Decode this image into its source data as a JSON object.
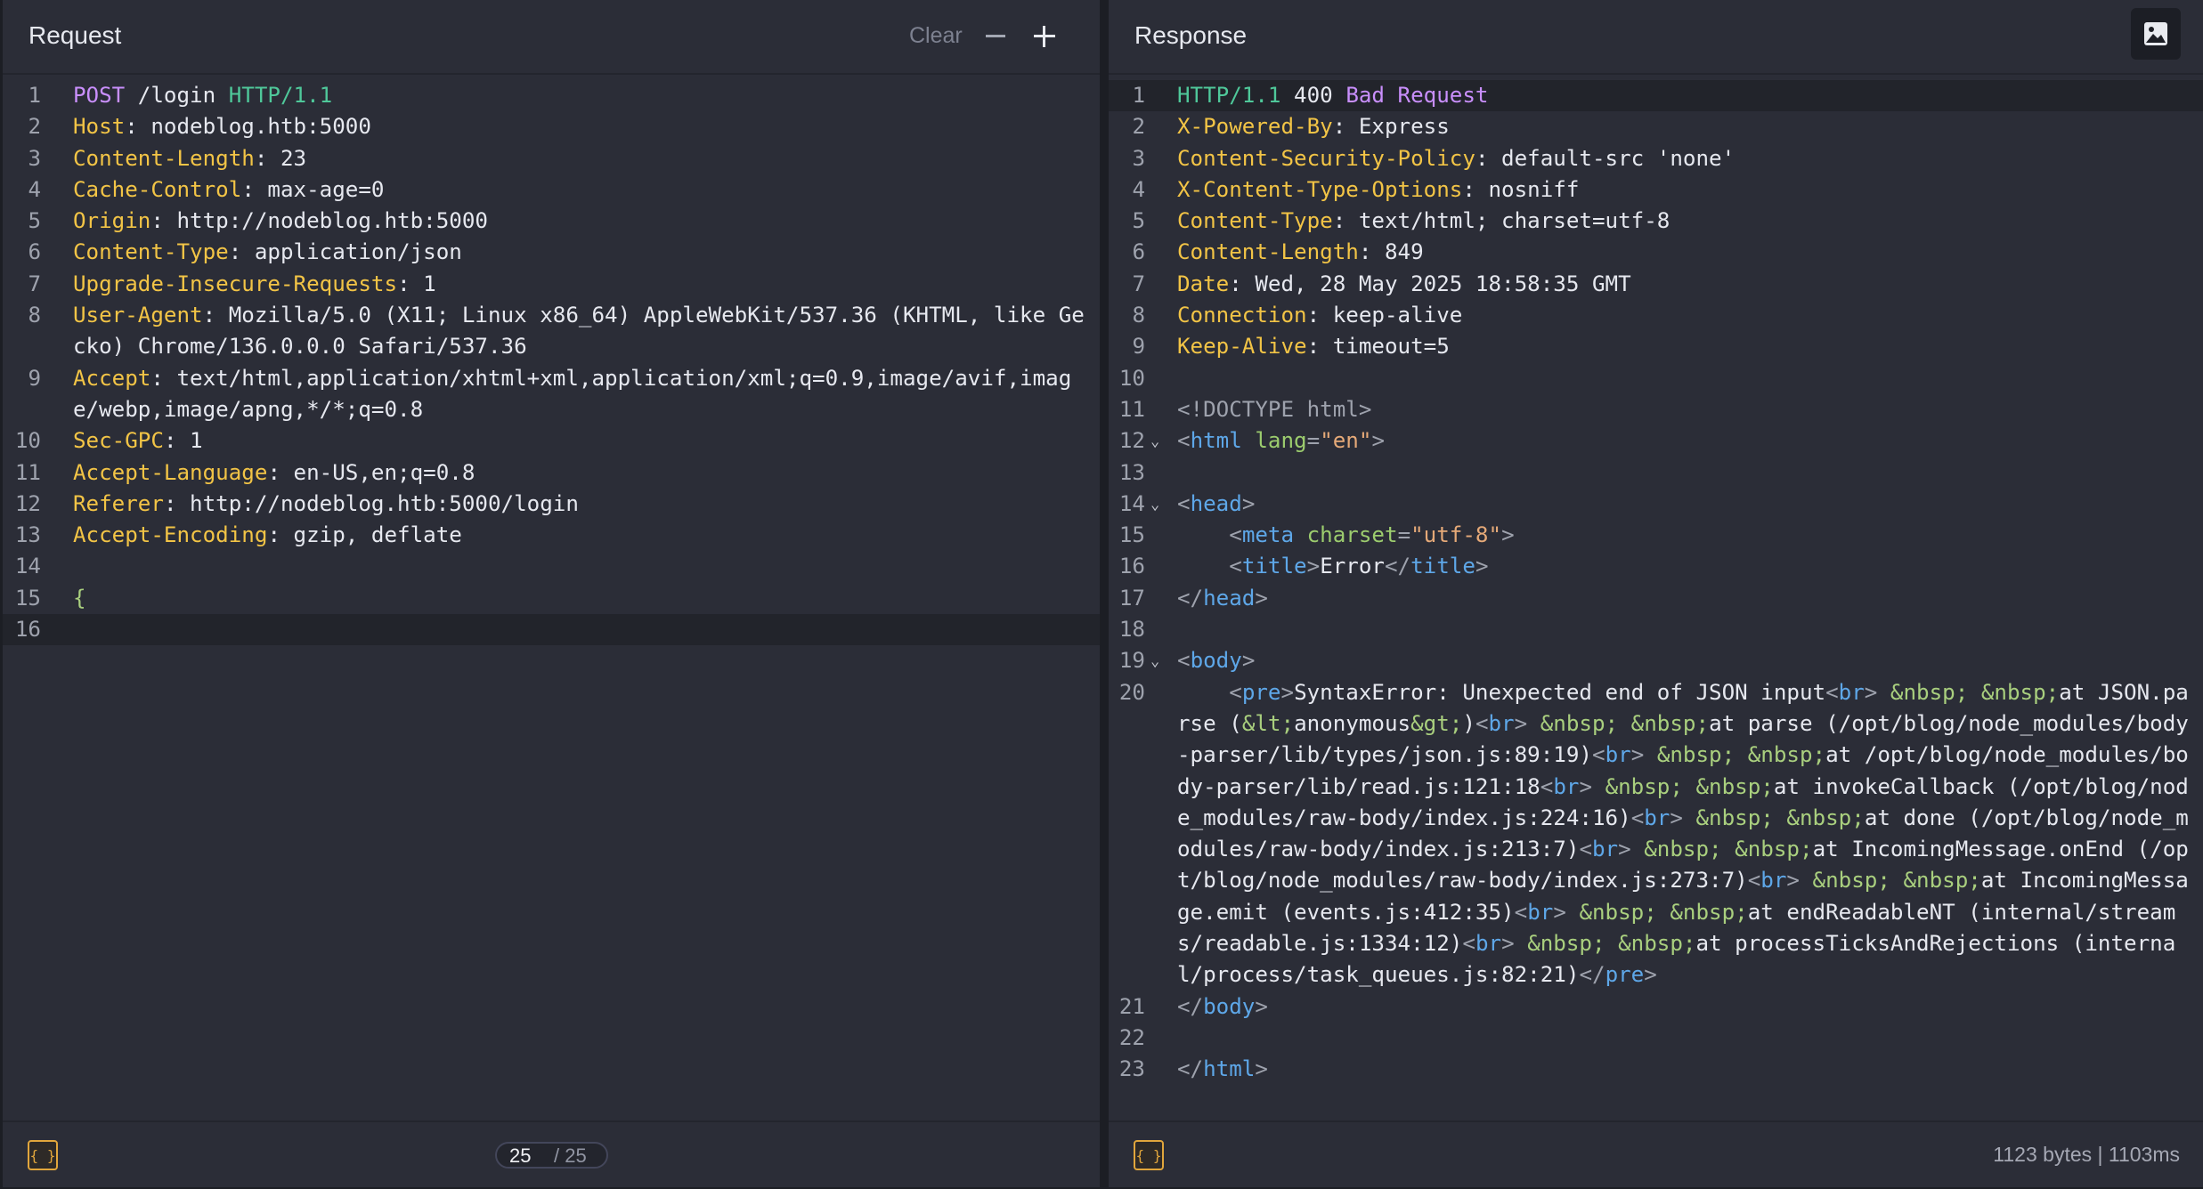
{
  "request": {
    "title": "Request",
    "clear_label": "Clear",
    "lines": [
      {
        "n": "1",
        "segs": [
          [
            "POST",
            "purple"
          ],
          [
            " /login ",
            ""
          ],
          [
            "HTTP/1.1",
            "green"
          ]
        ]
      },
      {
        "n": "2",
        "segs": [
          [
            "Host",
            "yellow"
          ],
          [
            ": nodeblog.htb:5000",
            ""
          ]
        ]
      },
      {
        "n": "3",
        "segs": [
          [
            "Content-Length",
            "yellow"
          ],
          [
            ": 23",
            ""
          ]
        ]
      },
      {
        "n": "4",
        "segs": [
          [
            "Cache-Control",
            "yellow"
          ],
          [
            ": max-age=0",
            ""
          ]
        ]
      },
      {
        "n": "5",
        "segs": [
          [
            "Origin",
            "yellow"
          ],
          [
            ": http://nodeblog.htb:5000",
            ""
          ]
        ]
      },
      {
        "n": "6",
        "segs": [
          [
            "Content-Type",
            "yellow"
          ],
          [
            ": application/json",
            ""
          ]
        ]
      },
      {
        "n": "7",
        "segs": [
          [
            "Upgrade-Insecure-Requests",
            "yellow"
          ],
          [
            ": 1",
            ""
          ]
        ]
      },
      {
        "n": "8",
        "segs": [
          [
            "User-Agent",
            "yellow"
          ],
          [
            ": Mozilla/5.0 (X11; Linux x86_64) AppleWebKit/537.36 (KHTML, like Gecko) Chrome/136.0.0.0 Safari/537.36",
            ""
          ]
        ]
      },
      {
        "n": "9",
        "segs": [
          [
            "Accept",
            "yellow"
          ],
          [
            ": text/html,application/xhtml+xml,application/xml;q=0.9,image/avif,image/webp,image/apng,*/*;q=0.8",
            ""
          ]
        ]
      },
      {
        "n": "10",
        "segs": [
          [
            "Sec-GPC",
            "yellow"
          ],
          [
            ": 1",
            ""
          ]
        ]
      },
      {
        "n": "11",
        "segs": [
          [
            "Accept-Language",
            "yellow"
          ],
          [
            ": en-US,en;q=0.8",
            ""
          ]
        ]
      },
      {
        "n": "12",
        "segs": [
          [
            "Referer",
            "yellow"
          ],
          [
            ": http://nodeblog.htb:5000/login",
            ""
          ]
        ]
      },
      {
        "n": "13",
        "segs": [
          [
            "Accept-Encoding",
            "yellow"
          ],
          [
            ": gzip, deflate",
            ""
          ]
        ]
      },
      {
        "n": "14",
        "segs": []
      },
      {
        "n": "15",
        "segs": [
          [
            "{",
            "ent"
          ]
        ]
      },
      {
        "n": "16",
        "segs": [],
        "active": true
      }
    ],
    "pager": {
      "current": "25",
      "total": "/ 25"
    }
  },
  "response": {
    "title": "Response",
    "lines": [
      {
        "n": "1",
        "active": true,
        "segs": [
          [
            "HTTP/1.1",
            "green"
          ],
          [
            " 400 ",
            ""
          ],
          [
            "Bad Request",
            "purple"
          ]
        ]
      },
      {
        "n": "2",
        "segs": [
          [
            "X-Powered-By",
            "yellow"
          ],
          [
            ": Express",
            ""
          ]
        ]
      },
      {
        "n": "3",
        "segs": [
          [
            "Content-Security-Policy",
            "yellow"
          ],
          [
            ": default-src 'none'",
            ""
          ]
        ]
      },
      {
        "n": "4",
        "segs": [
          [
            "X-Content-Type-Options",
            "yellow"
          ],
          [
            ": nosniff",
            ""
          ]
        ]
      },
      {
        "n": "5",
        "segs": [
          [
            "Content-Type",
            "yellow"
          ],
          [
            ": text/html; charset=utf-8",
            ""
          ]
        ]
      },
      {
        "n": "6",
        "segs": [
          [
            "Content-Length",
            "yellow"
          ],
          [
            ": 849",
            ""
          ]
        ]
      },
      {
        "n": "7",
        "segs": [
          [
            "Date",
            "yellow"
          ],
          [
            ": Wed, 28 May 2025 18:58:35 GMT",
            ""
          ]
        ]
      },
      {
        "n": "8",
        "segs": [
          [
            "Connection",
            "yellow"
          ],
          [
            ": keep-alive",
            ""
          ]
        ]
      },
      {
        "n": "9",
        "segs": [
          [
            "Keep-Alive",
            "yellow"
          ],
          [
            ": timeout=5",
            ""
          ]
        ]
      },
      {
        "n": "10",
        "segs": []
      },
      {
        "n": "11",
        "segs": [
          [
            "<!DOCTYPE html>",
            "gray"
          ]
        ]
      },
      {
        "n": "12",
        "fold": true,
        "segs": [
          [
            "<",
            "gray"
          ],
          [
            "html",
            "tag"
          ],
          [
            " ",
            ""
          ],
          [
            "lang",
            "attr"
          ],
          [
            "=",
            "gray"
          ],
          [
            "\"en\"",
            "str"
          ],
          [
            ">",
            "gray"
          ]
        ]
      },
      {
        "n": "13",
        "segs": []
      },
      {
        "n": "14",
        "fold": true,
        "segs": [
          [
            "<",
            "gray"
          ],
          [
            "head",
            "tag"
          ],
          [
            ">",
            "gray"
          ]
        ]
      },
      {
        "n": "15",
        "segs": [
          [
            "    <",
            "gray"
          ],
          [
            "meta",
            "tag"
          ],
          [
            " ",
            ""
          ],
          [
            "charset",
            "attr"
          ],
          [
            "=",
            "gray"
          ],
          [
            "\"utf-8\"",
            "str"
          ],
          [
            ">",
            "gray"
          ]
        ]
      },
      {
        "n": "16",
        "segs": [
          [
            "    <",
            "gray"
          ],
          [
            "title",
            "tag"
          ],
          [
            ">",
            "gray"
          ],
          [
            "Error",
            ""
          ],
          [
            "</",
            "gray"
          ],
          [
            "title",
            "tag"
          ],
          [
            ">",
            "gray"
          ]
        ]
      },
      {
        "n": "17",
        "segs": [
          [
            "</",
            "gray"
          ],
          [
            "head",
            "tag"
          ],
          [
            ">",
            "gray"
          ]
        ]
      },
      {
        "n": "18",
        "segs": []
      },
      {
        "n": "19",
        "fold": true,
        "segs": [
          [
            "<",
            "gray"
          ],
          [
            "body",
            "tag"
          ],
          [
            ">",
            "gray"
          ]
        ]
      },
      {
        "n": "20",
        "segs": [
          [
            "    <",
            "gray"
          ],
          [
            "pre",
            "tag"
          ],
          [
            ">",
            "gray"
          ],
          [
            "SyntaxError: Unexpected end of JSON input",
            ""
          ],
          [
            "<",
            "gray"
          ],
          [
            "br",
            "tag"
          ],
          [
            "> ",
            "gray"
          ],
          [
            "&nbsp; &nbsp;",
            "ent"
          ],
          [
            "at JSON.parse (",
            ""
          ],
          [
            "&lt;",
            "ent"
          ],
          [
            "anonymous",
            ""
          ],
          [
            "&gt;",
            "ent"
          ],
          [
            ")",
            ""
          ],
          [
            "<",
            "gray"
          ],
          [
            "br",
            "tag"
          ],
          [
            "> ",
            "gray"
          ],
          [
            "&nbsp; &nbsp;",
            "ent"
          ],
          [
            "at parse (/opt/blog/node_modules/body-parser/lib/types/json.js:89:19)",
            ""
          ],
          [
            "<",
            "gray"
          ],
          [
            "br",
            "tag"
          ],
          [
            "> ",
            "gray"
          ],
          [
            "&nbsp; &nbsp;",
            "ent"
          ],
          [
            "at /opt/blog/node_modules/body-parser/lib/read.js:121:18",
            ""
          ],
          [
            "<",
            "gray"
          ],
          [
            "br",
            "tag"
          ],
          [
            "> ",
            "gray"
          ],
          [
            "&nbsp; &nbsp;",
            "ent"
          ],
          [
            "at invokeCallback (/opt/blog/node_modules/raw-body/index.js:224:16)",
            ""
          ],
          [
            "<",
            "gray"
          ],
          [
            "br",
            "tag"
          ],
          [
            "> ",
            "gray"
          ],
          [
            "&nbsp; &nbsp;",
            "ent"
          ],
          [
            "at done (/opt/blog/node_modules/raw-body/index.js:213:7)",
            ""
          ],
          [
            "<",
            "gray"
          ],
          [
            "br",
            "tag"
          ],
          [
            "> ",
            "gray"
          ],
          [
            "&nbsp; &nbsp;",
            "ent"
          ],
          [
            "at IncomingMessage.onEnd (/opt/blog/node_modules/raw-body/index.js:273:7)",
            ""
          ],
          [
            "<",
            "gray"
          ],
          [
            "br",
            "tag"
          ],
          [
            "> ",
            "gray"
          ],
          [
            "&nbsp; &nbsp;",
            "ent"
          ],
          [
            "at IncomingMessage.emit (events.js:412:35)",
            ""
          ],
          [
            "<",
            "gray"
          ],
          [
            "br",
            "tag"
          ],
          [
            "> ",
            "gray"
          ],
          [
            "&nbsp; &nbsp;",
            "ent"
          ],
          [
            "at endReadableNT (internal/streams/readable.js:1334:12)",
            ""
          ],
          [
            "<",
            "gray"
          ],
          [
            "br",
            "tag"
          ],
          [
            "> ",
            "gray"
          ],
          [
            "&nbsp; &nbsp;",
            "ent"
          ],
          [
            "at processTicksAndRejections (internal/process/task_queues.js:82:21)",
            ""
          ],
          [
            "</",
            "gray"
          ],
          [
            "pre",
            "tag"
          ],
          [
            ">",
            "gray"
          ]
        ]
      },
      {
        "n": "21",
        "segs": [
          [
            "</",
            "gray"
          ],
          [
            "body",
            "tag"
          ],
          [
            ">",
            "gray"
          ]
        ]
      },
      {
        "n": "22",
        "segs": []
      },
      {
        "n": "23",
        "segs": [
          [
            "</",
            "gray"
          ],
          [
            "html",
            "tag"
          ],
          [
            ">",
            "gray"
          ]
        ]
      }
    ],
    "stats": "1123 bytes  |  1103ms"
  },
  "footer": {
    "format_label": "{ }"
  },
  "icons": {
    "format": "format-braces-icon",
    "image": "image-icon",
    "minus": "minus-icon",
    "plus": "plus-icon"
  }
}
